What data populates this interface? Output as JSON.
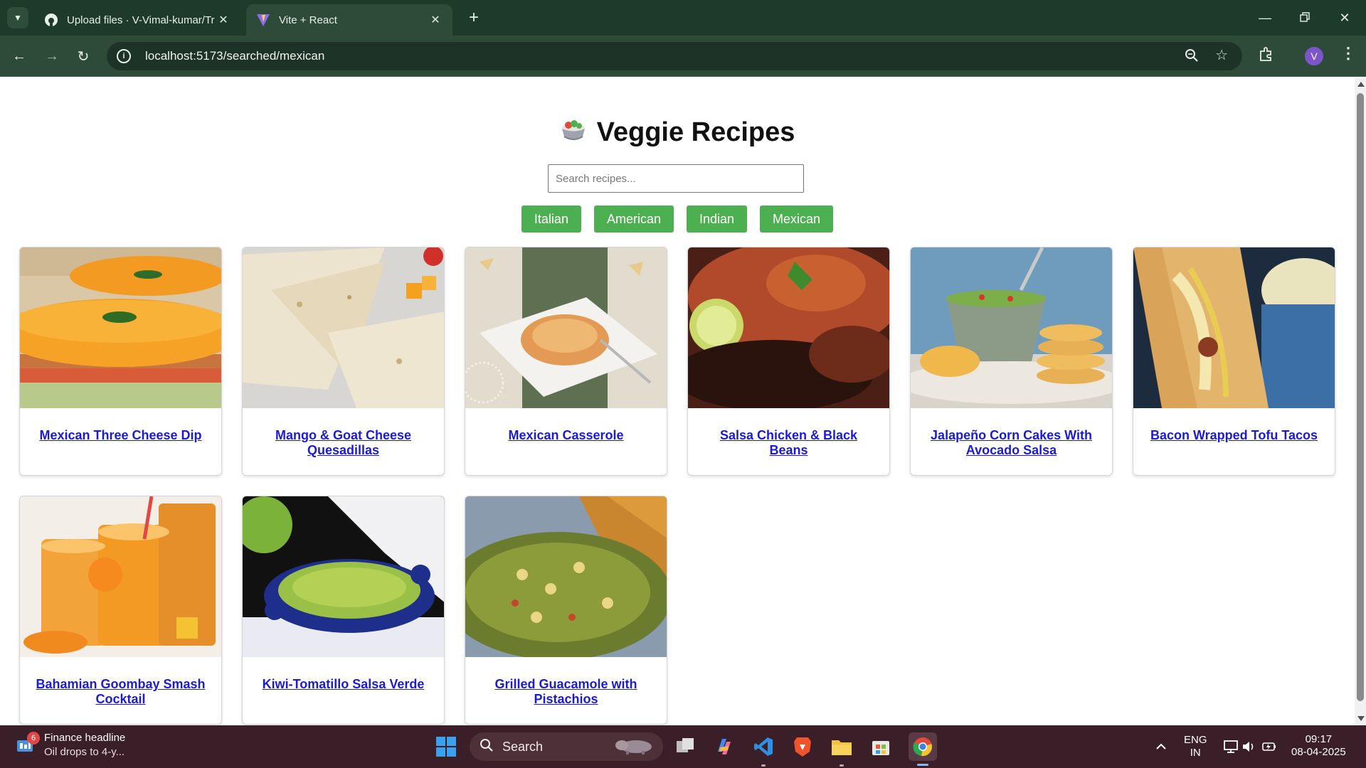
{
  "browser": {
    "tabs": [
      {
        "title": "Upload files · V-Vimal-kumar/Tr",
        "icon": "github-icon",
        "active": false
      },
      {
        "title": "Vite + React",
        "icon": "vite-icon",
        "active": true
      }
    ],
    "url": "localhost:5173/searched/mexican",
    "profile_initial": "V"
  },
  "page": {
    "heading": "Veggie Recipes",
    "heading_icon": "salad-bowl-icon",
    "search_placeholder": "Search recipes...",
    "search_value": "",
    "cuisines": [
      "Italian",
      "American",
      "Indian",
      "Mexican"
    ],
    "accent_color": "#4caf50",
    "link_color": "#1b1bd6",
    "recipes": [
      {
        "title": "Mexican Three Cheese Dip",
        "image": "layered cheese dip"
      },
      {
        "title": "Mango & Goat Cheese Quesadillas",
        "image": "quesadilla wedges"
      },
      {
        "title": "Mexican Casserole",
        "image": "casserole on plate"
      },
      {
        "title": "Salsa Chicken & Black Beans",
        "image": "salsa chicken with lime"
      },
      {
        "title": "Jalapeño Corn Cakes With Avocado Salsa",
        "image": "corn cakes with salsa"
      },
      {
        "title": "Bacon Wrapped Tofu Tacos",
        "image": "taco with dip"
      },
      {
        "title": "Bahamian Goombay Smash Cocktail",
        "image": "orange cocktail glasses"
      },
      {
        "title": "Kiwi-Tomatillo Salsa Verde",
        "image": "green salsa in blue bowl"
      },
      {
        "title": "Grilled Guacamole with Pistachios",
        "image": "guacamole with chips"
      }
    ]
  },
  "taskbar": {
    "news_title": "Finance headline",
    "news_sub": "Oil drops to 4-y...",
    "news_badge": "6",
    "search_label": "Search",
    "language_top": "ENG",
    "language_bottom": "IN",
    "time": "09:17",
    "date": "08-04-2025"
  }
}
